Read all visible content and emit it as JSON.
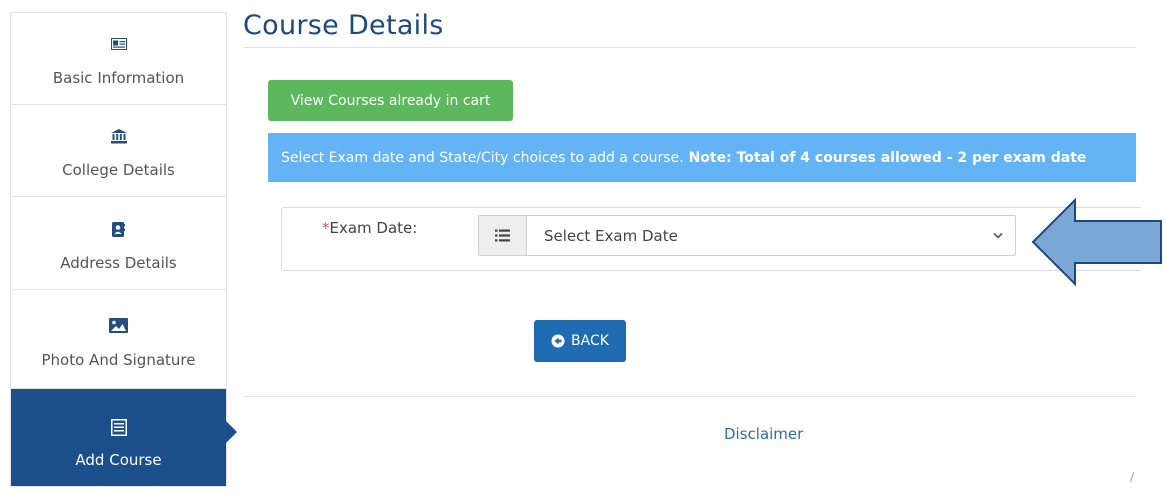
{
  "sidebar": {
    "items": [
      {
        "label": "Basic Information",
        "icon": "id-card-icon",
        "active": false
      },
      {
        "label": "College Details",
        "icon": "institution-icon",
        "active": false
      },
      {
        "label": "Address Details",
        "icon": "address-book-icon",
        "active": false
      },
      {
        "label": "Photo And Signature",
        "icon": "image-icon",
        "active": false
      },
      {
        "label": "Add Course",
        "icon": "list-icon",
        "active": true
      }
    ]
  },
  "main": {
    "title": "Course Details",
    "view_cart_button": "View Courses already in cart",
    "notice": {
      "text": "Select Exam date and State/City choices to add a course.",
      "bold_text": "Note: Total of 4 courses allowed - 2 per exam date"
    },
    "exam_date": {
      "required_mark": "*",
      "label": "Exam Date:",
      "selected": "Select Exam Date"
    },
    "back_button": "BACK",
    "disclaimer_link": "Disclaimer",
    "corner_mark": "/"
  },
  "colors": {
    "accent_blue": "#1b4f8c",
    "green_button": "#5cb85c",
    "notice_blue": "#63b3f5",
    "back_button": "#1f6cb3",
    "arrow_fill": "#7aa7d6"
  }
}
